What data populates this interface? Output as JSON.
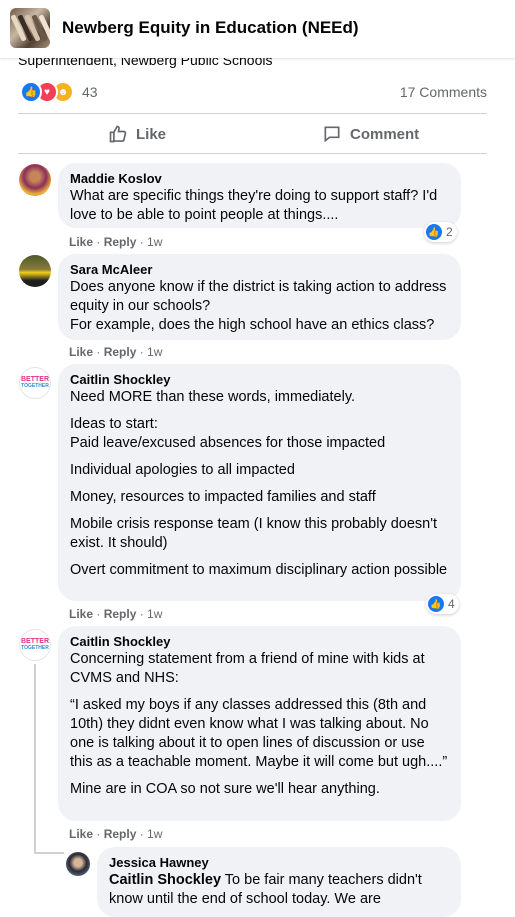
{
  "header": {
    "title": "Newberg Equity in Education (NEEd)"
  },
  "post": {
    "cut_text": "Superintendent, Newberg Public Schools",
    "reaction_count": "43",
    "comments_count": "17 Comments",
    "like_label": "Like",
    "comment_label": "Comment"
  },
  "comments": [
    {
      "author": "Maddie Koslov",
      "paragraphs": [
        "What are specific things they're doing to support staff? I'd love to be able to point people at things...."
      ],
      "like": "Like",
      "reply": "Reply",
      "time": "1w",
      "reactions": "2"
    },
    {
      "author": "Sara McAleer",
      "paragraphs": [
        "Does anyone know if the district is taking action to address equity in our schools?",
        "For example, does the high school have an ethics class?"
      ],
      "like": "Like",
      "reply": "Reply",
      "time": "1w"
    },
    {
      "author": "Caitlin Shockley",
      "avatar_text": [
        "BETTER",
        "TOGETHER"
      ],
      "paragraphs": [
        "Need MORE than these words, immediately.",
        "Ideas to start:",
        "Paid leave/excused absences for those impacted",
        "Individual apologies to all impacted",
        "Money, resources to impacted families and staff",
        "Mobile crisis response team (I know this probably doesn't exist. It should)",
        "Overt commitment to maximum disciplinary action possible"
      ],
      "like": "Like",
      "reply": "Reply",
      "time": "1w",
      "reactions": "4"
    },
    {
      "author": "Caitlin Shockley",
      "avatar_text": [
        "BETTER",
        "TOGETHER"
      ],
      "paragraphs": [
        "Concerning statement from a friend of mine with kids at CVMS and NHS:",
        "“I asked my boys if any classes addressed this (8th and 10th) they didnt even know what I was talking about. No one is talking about it to open lines of discussion or use this as a teachable moment. Maybe it will come but ugh....”",
        "Mine are in COA so not sure we'll hear anything."
      ],
      "like": "Like",
      "reply": "Reply",
      "time": "1w"
    },
    {
      "author": "Jessica Hawney",
      "mention": "Caitlin Shockley",
      "text": "To be fair many teachers didn't know until the end of school today. We are"
    }
  ],
  "colors": {
    "accent": "#1877f2",
    "bubble": "#f0f2f5",
    "secondary_text": "#65676b"
  }
}
